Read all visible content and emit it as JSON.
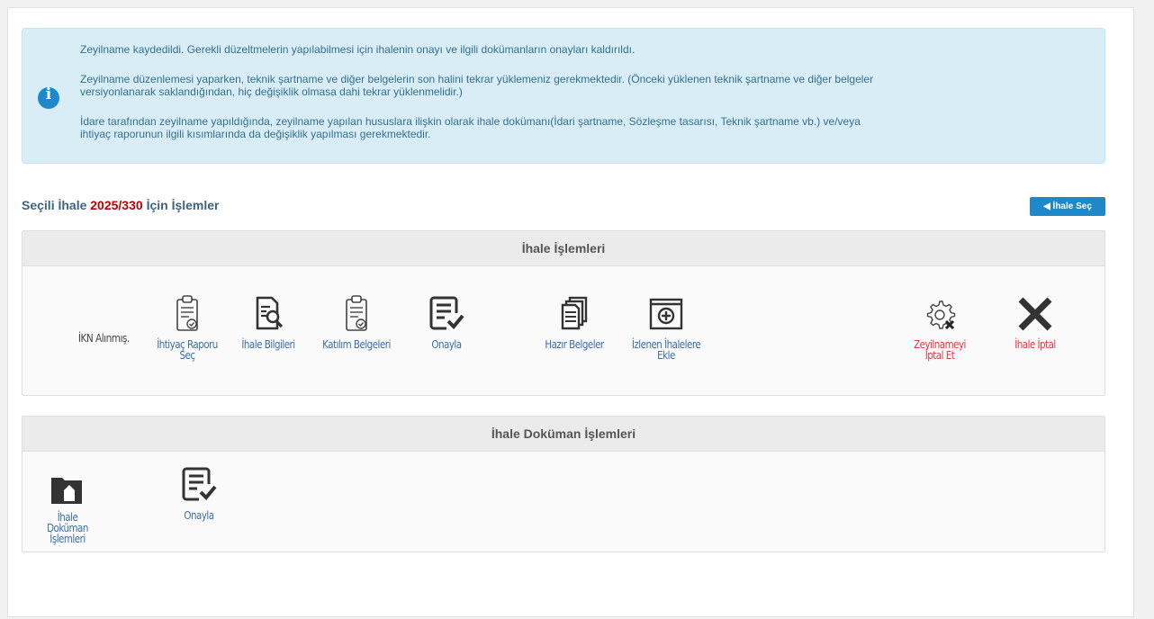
{
  "alert": {
    "line1": "Zeyilname kaydedildi. Gerekli düzeltmelerin yapılabilmesi için ihalenin onayı ve ilgili dokümanların onayları kaldırıldı.",
    "line2a": "Zeyilname düzenlemesi yaparken, teknik şartname ve diğer belgelerin son halini tekrar yüklemeniz gerekmektedir. (Önceki yüklenen teknik şartname ve diğer belgeler",
    "line2b": "versiyonlanarak saklandığından, hiç değişiklik olmasa dahi tekrar yüklenmelidir.)",
    "line3a": "İdare tarafından zeyilname yapıldığında, zeyilname yapılan hususlara ilişkin olarak ihale dokümanı(İdari şartname, Sözleşme tasarısı, Teknik şartname vb.) ve/veya",
    "line3b": "ihtiyaç raporunun ilgili kısımlarında da değişiklik yapılması gerekmektedir."
  },
  "selection": {
    "prefix": "Seçili İhale",
    "ihale_no": "2025/330",
    "suffix": "İçin İşlemler",
    "back_button": "◀ İhale Seç"
  },
  "ihale_islemleri": {
    "title": "İhale İşlemleri",
    "status": "İKN Alınmış.",
    "items": [
      {
        "label": "İhtiyaç Raporu Seç",
        "icon": "clipboard-check-icon"
      },
      {
        "label": "İhale Bilgileri",
        "icon": "document-search-icon"
      },
      {
        "label": "Katılım Belgeleri",
        "icon": "clipboard-check-icon"
      },
      {
        "label": "Onayla",
        "icon": "list-check-icon"
      },
      {
        "label": "Hazır Belgeler",
        "icon": "documents-stack-icon"
      },
      {
        "label": "İzlenen İhalelere Ekle",
        "icon": "calendar-add-icon"
      },
      {
        "label": "Zeyilnameyi İptal Et",
        "icon": "gear-cancel-icon"
      },
      {
        "label": "İhale İptal",
        "icon": "close-x-icon"
      }
    ]
  },
  "dokuman_islemleri": {
    "title": "İhale Doküman İşlemleri",
    "items": [
      {
        "label": "İhale Doküman İşlemleri",
        "icon": "folder-open-icon"
      },
      {
        "label": "Onayla",
        "icon": "list-check-icon"
      }
    ]
  },
  "colors": {
    "accent": "#1e88c8",
    "ihale_no": "#c00000",
    "danger_label": "#e0383e",
    "link_label": "#3a6ea8"
  }
}
